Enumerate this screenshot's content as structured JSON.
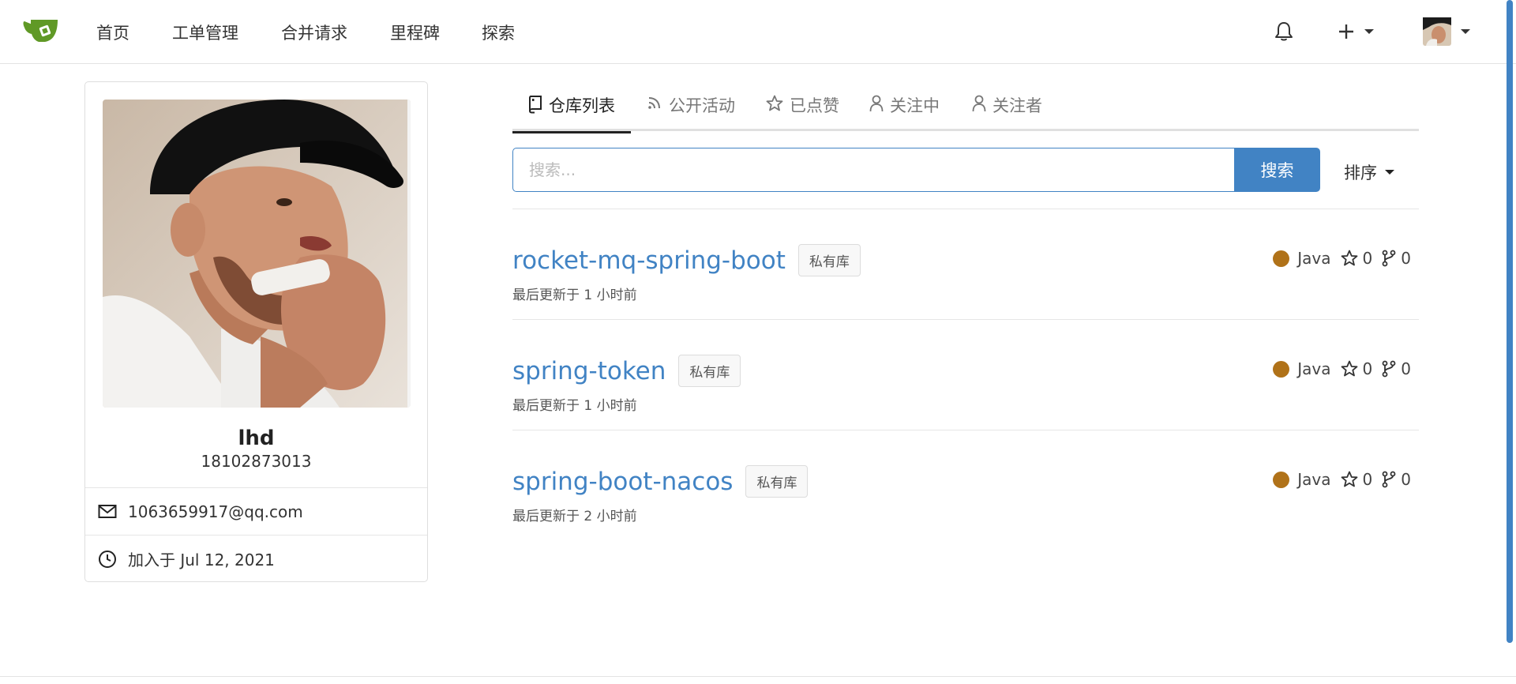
{
  "nav": {
    "items": [
      "首页",
      "工单管理",
      "合并请求",
      "里程碑",
      "探索"
    ]
  },
  "profile": {
    "name": "lhd",
    "phone": "18102873013",
    "email": "1063659917@qq.com",
    "joined": "加入于 Jul 12, 2021"
  },
  "tabs": [
    {
      "label": "仓库列表",
      "icon": "repo-icon",
      "active": true
    },
    {
      "label": "公开活动",
      "icon": "rss-icon",
      "active": false
    },
    {
      "label": "已点赞",
      "icon": "star-icon",
      "active": false
    },
    {
      "label": "关注中",
      "icon": "person-icon",
      "active": false
    },
    {
      "label": "关注者",
      "icon": "person-icon",
      "active": false
    }
  ],
  "search": {
    "placeholder": "搜索...",
    "button": "搜索",
    "sort": "排序"
  },
  "repos": [
    {
      "name": "rocket-mq-spring-boot",
      "badge": "私有库",
      "updated": "最后更新于 1 小时前",
      "language": "Java",
      "stars": "0",
      "forks": "0"
    },
    {
      "name": "spring-token",
      "badge": "私有库",
      "updated": "最后更新于 1 小时前",
      "language": "Java",
      "stars": "0",
      "forks": "0"
    },
    {
      "name": "spring-boot-nacos",
      "badge": "私有库",
      "updated": "最后更新于 2 小时前",
      "language": "Java",
      "stars": "0",
      "forks": "0"
    }
  ],
  "colors": {
    "accent": "#4183c4",
    "java": "#b07219"
  }
}
